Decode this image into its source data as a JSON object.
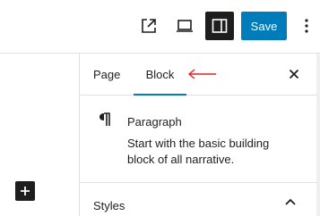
{
  "toolbar": {
    "external_icon": "external-link-icon",
    "preview_icon": "desktop-preview-icon",
    "settings_icon": "sidebar-settings-icon",
    "save_label": "Save",
    "more_icon": "more-vertical-icon",
    "accent_color": "#007cba"
  },
  "canvas": {
    "inserter_icon": "plus-icon"
  },
  "sidebar": {
    "tabs": [
      {
        "label": "Page",
        "active": false
      },
      {
        "label": "Block",
        "active": true
      }
    ],
    "close_icon": "close-icon",
    "annotation_icon": "red-arrow-icon",
    "annotation_color": "#e32222",
    "block": {
      "icon": "paragraph-icon",
      "title": "Paragraph",
      "description": "Start with the basic building block of all narrative."
    },
    "styles_panel": {
      "label": "Styles",
      "expanded": true,
      "toggle_icon": "chevron-up-icon"
    }
  }
}
